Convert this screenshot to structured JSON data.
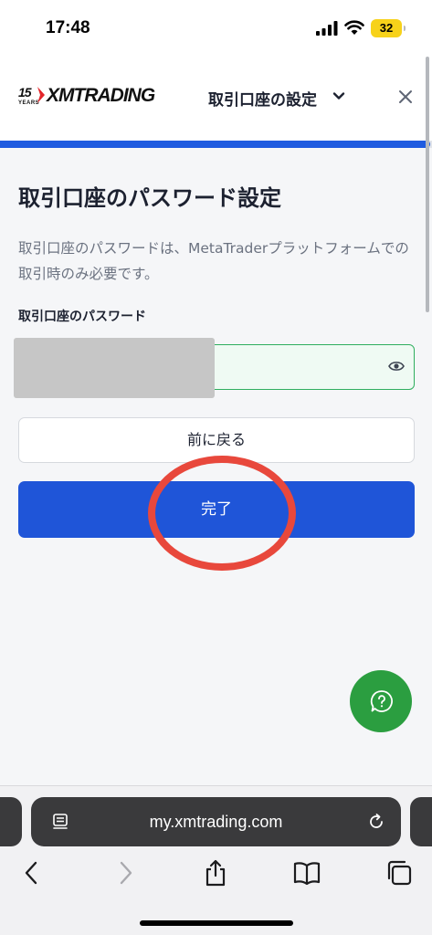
{
  "status_bar": {
    "time": "17:48",
    "battery": "32"
  },
  "header": {
    "logo_years": "15",
    "logo_years_caption": "YEARS",
    "logo_text": "XMTRADING",
    "title": "取引口座の設定"
  },
  "progress": {
    "fraction": 0.995
  },
  "main": {
    "title": "取引口座のパスワード設定",
    "description": "取引口座のパスワードは、MetaTraderプラットフォームでの取引時のみ必要です。",
    "password_label": "取引口座のパスワード",
    "password_value": "",
    "back_label": "前に戻る",
    "complete_label": "完了"
  },
  "browser": {
    "url": "my.xmtrading.com"
  },
  "colors": {
    "accent": "#1f55d8",
    "progress": "#1f5be0",
    "field_border": "#2fae5e",
    "highlight": "#e8483c",
    "help": "#2b9e40"
  },
  "icons": {
    "signal": "cellular-signal-icon",
    "wifi": "wifi-icon",
    "chevron": "chevron-down-icon",
    "close": "close-icon",
    "eye": "eye-icon",
    "help": "question-icon",
    "reader": "reader-icon",
    "reload": "reload-icon",
    "back": "back-arrow-icon",
    "forward": "forward-arrow-icon",
    "share": "share-icon",
    "bookmarks": "bookmarks-icon",
    "tabs": "tabs-icon"
  }
}
